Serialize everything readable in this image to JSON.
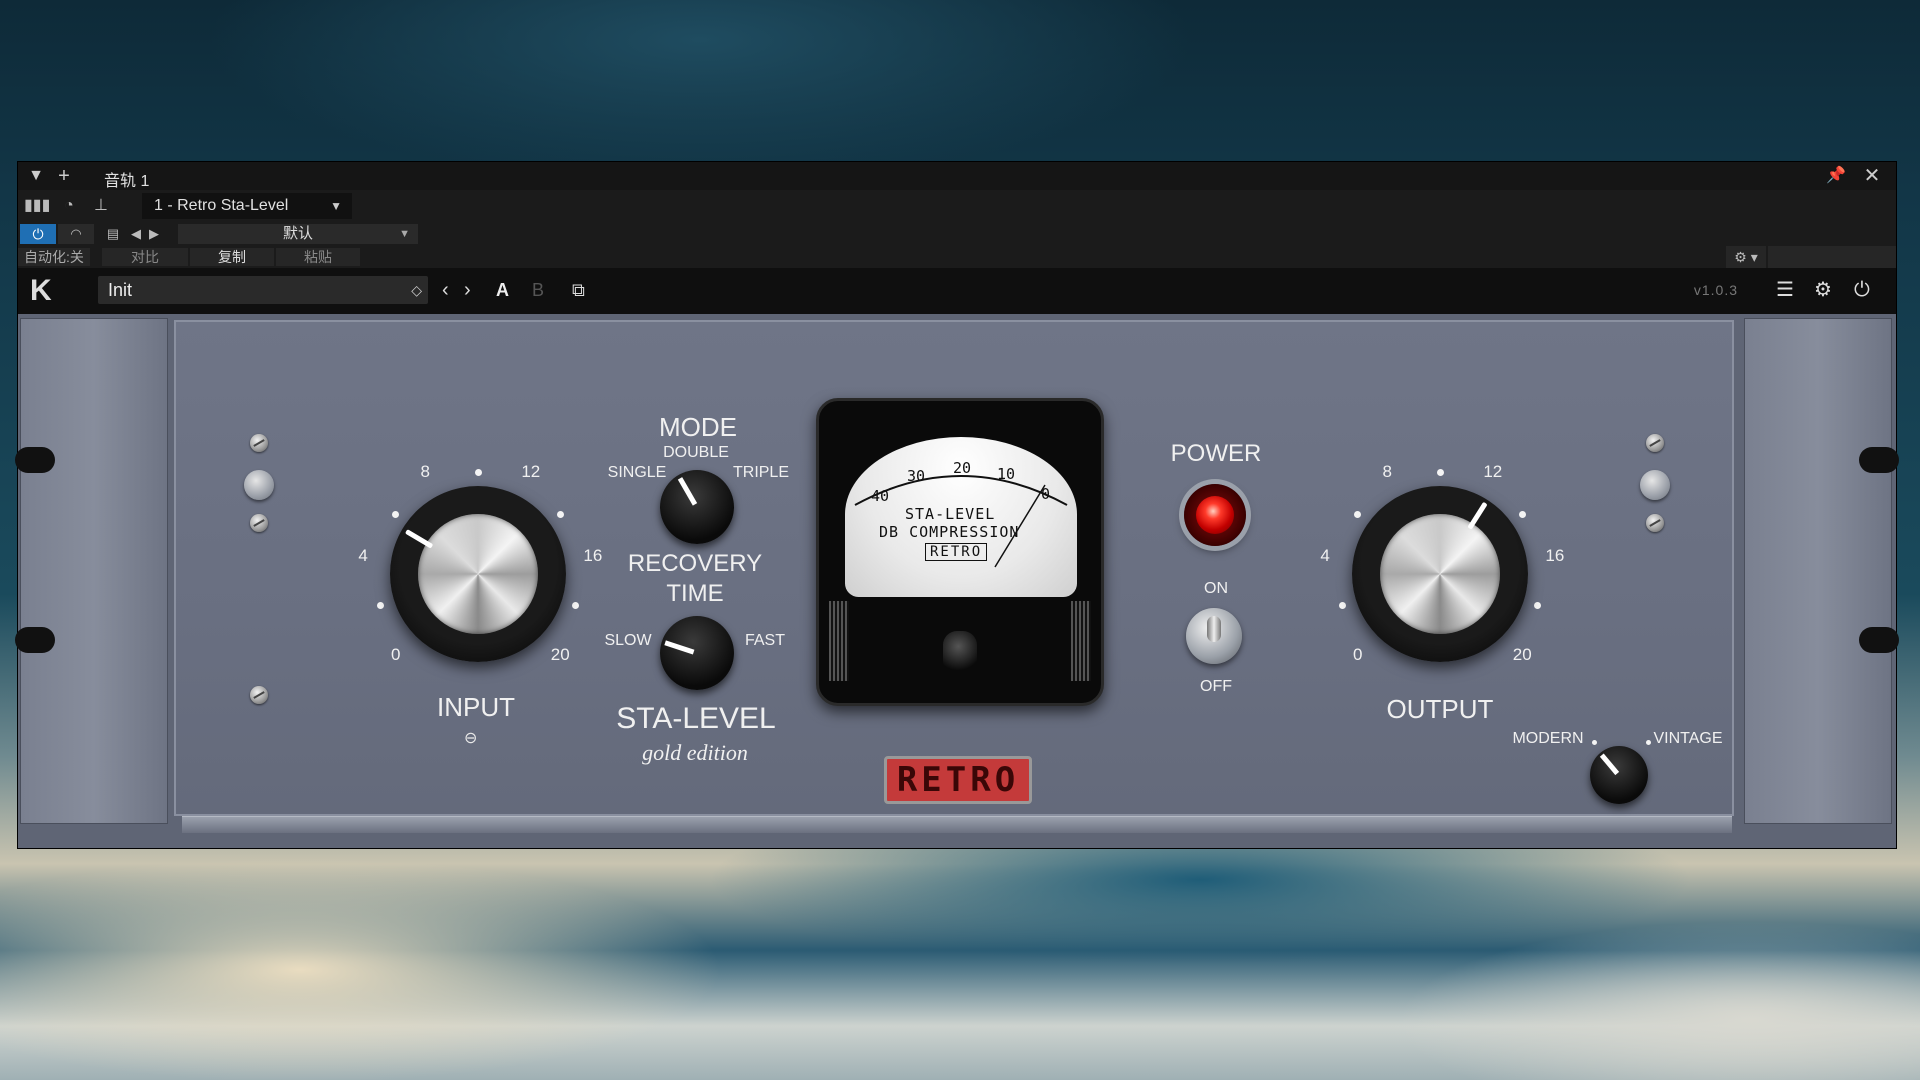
{
  "window": {
    "track_title": "音轨 1",
    "device_select": "1 - Retro Sta-Level",
    "preset_dropdown": "默认",
    "row_labels": {
      "automation": "自动化:关",
      "compare": "对比",
      "copy": "复制",
      "paste": "粘贴"
    }
  },
  "plugin_header": {
    "preset_name": "Init",
    "ab_a": "A",
    "ab_b": "B",
    "version": "v1.0.3"
  },
  "panel": {
    "input": {
      "label": "INPUT",
      "scale": [
        "0",
        "4",
        "8",
        "12",
        "16",
        "20"
      ],
      "value_fraction": 0.28
    },
    "mode": {
      "label": "MODE",
      "options": [
        "SINGLE",
        "DOUBLE",
        "TRIPLE"
      ],
      "selected": "DOUBLE"
    },
    "recovery": {
      "label_line1": "RECOVERY",
      "label_line2": "TIME",
      "min_label": "SLOW",
      "max_label": "FAST"
    },
    "brand": {
      "name": "STA-LEVEL",
      "edition": "gold edition"
    },
    "meter": {
      "scale": [
        "40",
        "30",
        "20",
        "10",
        "0"
      ],
      "line1": "STA-LEVEL",
      "line2": "DB COMPRESSION",
      "badge": "RETRO"
    },
    "power": {
      "label": "POWER",
      "on_label": "ON",
      "off_label": "OFF",
      "state": "ON"
    },
    "output": {
      "label": "OUTPUT",
      "scale": [
        "0",
        "4",
        "8",
        "12",
        "16",
        "20"
      ],
      "value_fraction": 0.62
    },
    "character": {
      "left_label": "MODERN",
      "right_label": "VINTAGE"
    },
    "logo_badge": "RETRO"
  },
  "colors": {
    "panel": "#6a7082",
    "accent_blue": "#1f6fb4",
    "badge_red": "#c43a3a",
    "lamp_red": "#ff3a2a"
  },
  "icons": [
    "chevron-down-icon",
    "plus-icon",
    "pin-icon",
    "close-icon",
    "bars-icon",
    "globe-icon",
    "routing-icon",
    "power-icon",
    "headphones-icon",
    "doc-icon",
    "arrow-left-icon",
    "arrow-right-icon",
    "gear-icon",
    "k-logo-icon",
    "updown-icon",
    "copy-icon",
    "sliders-icon",
    "link-icon"
  ]
}
